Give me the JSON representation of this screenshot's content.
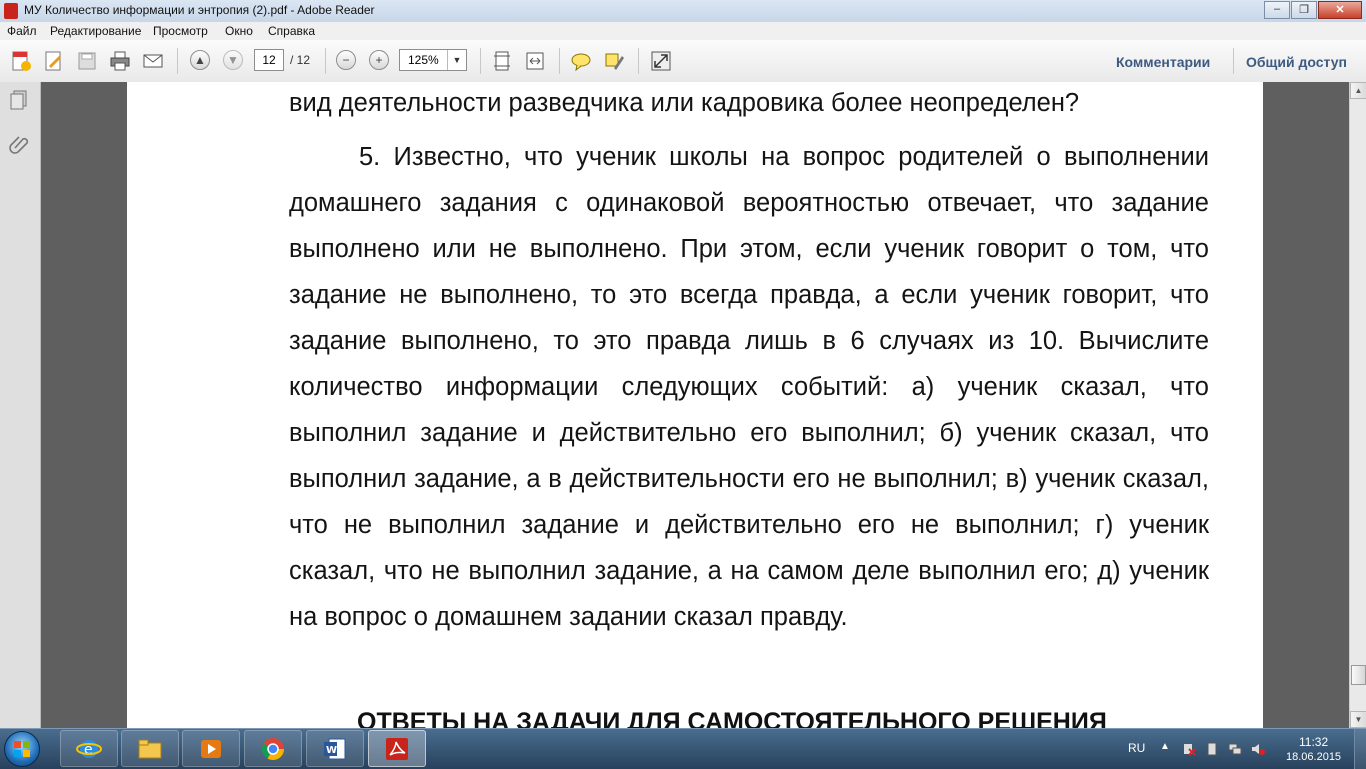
{
  "window": {
    "title": "МУ Количество информации и энтропия (2).pdf - Adobe Reader"
  },
  "menu": [
    "Файл",
    "Редактирование",
    "Просмотр",
    "Окно",
    "Справка"
  ],
  "toolbar": {
    "page_current": "12",
    "page_total": "/ 12",
    "zoom": "125%",
    "comments_label": "Комментарии",
    "share_label": "Общий доступ"
  },
  "document": {
    "top_line": "вид деятельности разведчика или кадровика более неопределен?",
    "main_paragraph": "5. Известно, что ученик школы на вопрос родителей о выполнении домашнего задания с одинаковой вероятностью отвечает, что задание выполнено или не выполнено. При этом, если ученик говорит о том, что задание не выполнено, то это всегда правда, а если ученик говорит, что задание выполнено, то это правда лишь в 6 случаях из 10. Вычислите количество информации следующих событий: а) ученик сказал, что выполнил задание и действительно его выполнил; б) ученик сказал, что выполнил задание, а в действительности его не выполнил; в) ученик сказал, что не выполнил задание и действительно его не выполнил; г) ученик сказал, что не выполнил задание, а на самом деле выполнил его; д) ученик на вопрос о домашнем задании сказал правду.",
    "section_heading": "ОТВЕТЫ НА ЗАДАЧИ ДЛЯ САМОСТОЯТЕЛЬНОГО РЕШЕНИЯ"
  },
  "taskbar": {
    "items": [
      "internet-explorer",
      "file-explorer",
      "media-player",
      "chrome",
      "word",
      "adobe-reader"
    ],
    "language": "RU",
    "time": "11:32",
    "date": "18.06.2015"
  },
  "colors": {
    "accent_link": "#3d5a80",
    "reader_red": "#c8241b",
    "taskbar": "#2d4a68"
  }
}
